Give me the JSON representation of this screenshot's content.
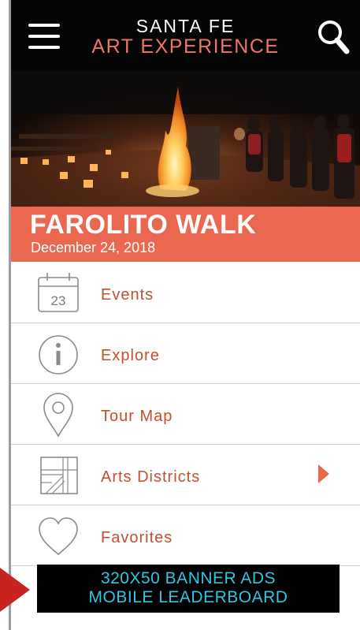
{
  "header": {
    "title_line1": "SANTA FE",
    "title_line2": "ART EXPERIENCE",
    "menu_icon": "hamburger-menu-icon",
    "search_icon": "search-icon"
  },
  "featured": {
    "title": "FAROLITO WALK",
    "date": "December 24, 2018",
    "image": "bonfire-night-photo"
  },
  "menu": {
    "items": [
      {
        "label": "Events",
        "icon": "calendar-icon",
        "icon_text": "23"
      },
      {
        "label": "Explore",
        "icon": "info-icon"
      },
      {
        "label": "Tour Map",
        "icon": "map-pin-icon"
      },
      {
        "label": "Arts Districts",
        "icon": "district-map-icon",
        "has_arrow": true
      },
      {
        "label": "Favorites",
        "icon": "heart-icon"
      }
    ]
  },
  "ad": {
    "line1": "320X50 BANNER ADS",
    "line2": "MOBILE LEADERBOARD"
  },
  "colors": {
    "header_bg": "#050505",
    "accent_salmon": "#ef7564",
    "banner_bg": "#e9684f",
    "menu_text": "#c1502e",
    "ad_text": "#2fc6df",
    "pointer": "#c8231f"
  }
}
